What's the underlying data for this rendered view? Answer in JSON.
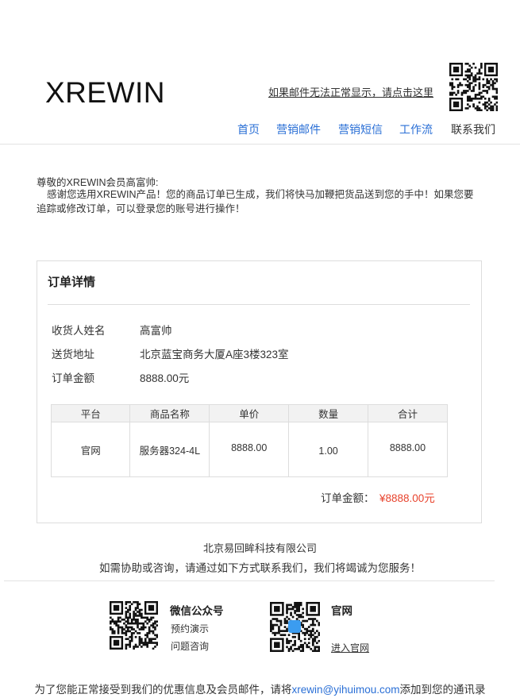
{
  "header": {
    "logo": "XREWIN",
    "view_link": "如果邮件无法正常显示，请点击这里",
    "nav": [
      {
        "label": "首页"
      },
      {
        "label": "营销邮件"
      },
      {
        "label": "营销短信"
      },
      {
        "label": "工作流"
      },
      {
        "label": "联系我们"
      }
    ]
  },
  "greeting": "尊敬的XREWIN会员高富帅:",
  "intro": "感谢您选用XREWIN产品！您的商品订单已生成，我们将快马加鞭把货品送到您的手中！如果您要追踪或修改订单，可以登录您的账号进行操作！",
  "order": {
    "title": "订单详情",
    "fields": [
      {
        "label": "收货人姓名",
        "value": "高富帅"
      },
      {
        "label": "送货地址",
        "value": "北京蓝宝商务大厦A座3楼323室"
      },
      {
        "label": "订单金额",
        "value": "8888.00元"
      }
    ],
    "table": {
      "columns": [
        "平台",
        "商品名称",
        "单价",
        "数量",
        "合计"
      ],
      "rows": [
        [
          "官网",
          "服务器324-4L",
          "8888.00",
          "1.00",
          "8888.00"
        ]
      ]
    },
    "total_label": "订单金额：",
    "total_value": "¥8888.00元"
  },
  "footer": {
    "company": "北京易回眸科技有限公司",
    "help": "如需协助或咨询，请通过如下方式联系我们，我们将竭诚为您服务！",
    "wechat": {
      "title": "微信公众号",
      "links": [
        "预约演示",
        "问题咨询"
      ]
    },
    "site": {
      "title": "官网",
      "link": "进入官网"
    },
    "bottom_prefix": "为了您能正常接受到我们的优惠信息及会员邮件，请将",
    "bottom_email": "xrewin@yihuimou.com",
    "bottom_suffix": "添加到您的通讯录"
  }
}
